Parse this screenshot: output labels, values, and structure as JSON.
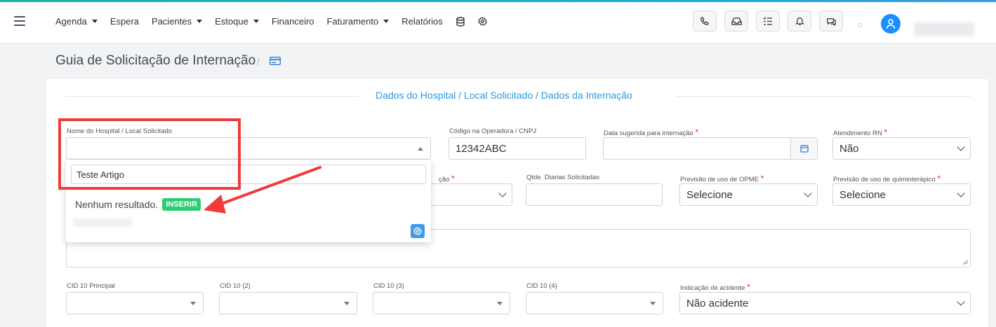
{
  "nav": {
    "items": [
      {
        "label": "Agenda",
        "dropdown": true
      },
      {
        "label": "Espera",
        "dropdown": false
      },
      {
        "label": "Pacientes",
        "dropdown": true
      },
      {
        "label": "Estoque",
        "dropdown": true
      },
      {
        "label": "Financeiro",
        "dropdown": false
      },
      {
        "label": "Faturamento",
        "dropdown": true
      },
      {
        "label": "Relatórios",
        "dropdown": false
      }
    ],
    "extra_icons": [
      "database-icon",
      "gear-icon"
    ],
    "toolbar_icons": [
      "phone-icon",
      "inbox-icon",
      "checklist-icon",
      "bell-icon",
      "chat-icon"
    ]
  },
  "page": {
    "title": "Guia de Solicitação de Internação",
    "separator": "/"
  },
  "section": {
    "legend": "Dados do Hospital / Local Solicitado / Dados da Internação"
  },
  "fields": {
    "hospital": {
      "label": "Nome do Hospital / Local Solicitado",
      "value": ""
    },
    "codigo": {
      "label": "Código na Operadora / CNPJ",
      "value": "12342ABC"
    },
    "data_sugerida": {
      "label": "Data sugerida para internação",
      "value": ""
    },
    "atendimento_rn": {
      "label": "Atendimento RN",
      "value": "Não"
    },
    "partial_label": "ção",
    "qtde_diarias": {
      "label": "Qtde. Diarias Solicitadas",
      "value": ""
    },
    "opme": {
      "label": "Previsão de uso de OPME",
      "value": "Selecione"
    },
    "quimio": {
      "label": "Previsão de uso de quimioterápico",
      "value": "Selecione"
    },
    "cid_principal": {
      "label": "CID 10 Principal",
      "value": ""
    },
    "cid2": {
      "label": "CID 10 (2)",
      "value": ""
    },
    "cid3": {
      "label": "CID 10 (3)",
      "value": ""
    },
    "cid4": {
      "label": "CID 10 (4)",
      "value": ""
    },
    "acidente": {
      "label": "Indicação de acidente",
      "value": "Não acidente"
    }
  },
  "required_marker": "*",
  "dropdown": {
    "search_value": "Teste Artigo",
    "no_result": "Nenhum resultado.",
    "insert_label": "INSERIR"
  },
  "colors": {
    "accent": "#2c9ae0",
    "highlight": "#ef3b3b",
    "insert": "#2ecc71",
    "avatar": "#1a90ff"
  }
}
